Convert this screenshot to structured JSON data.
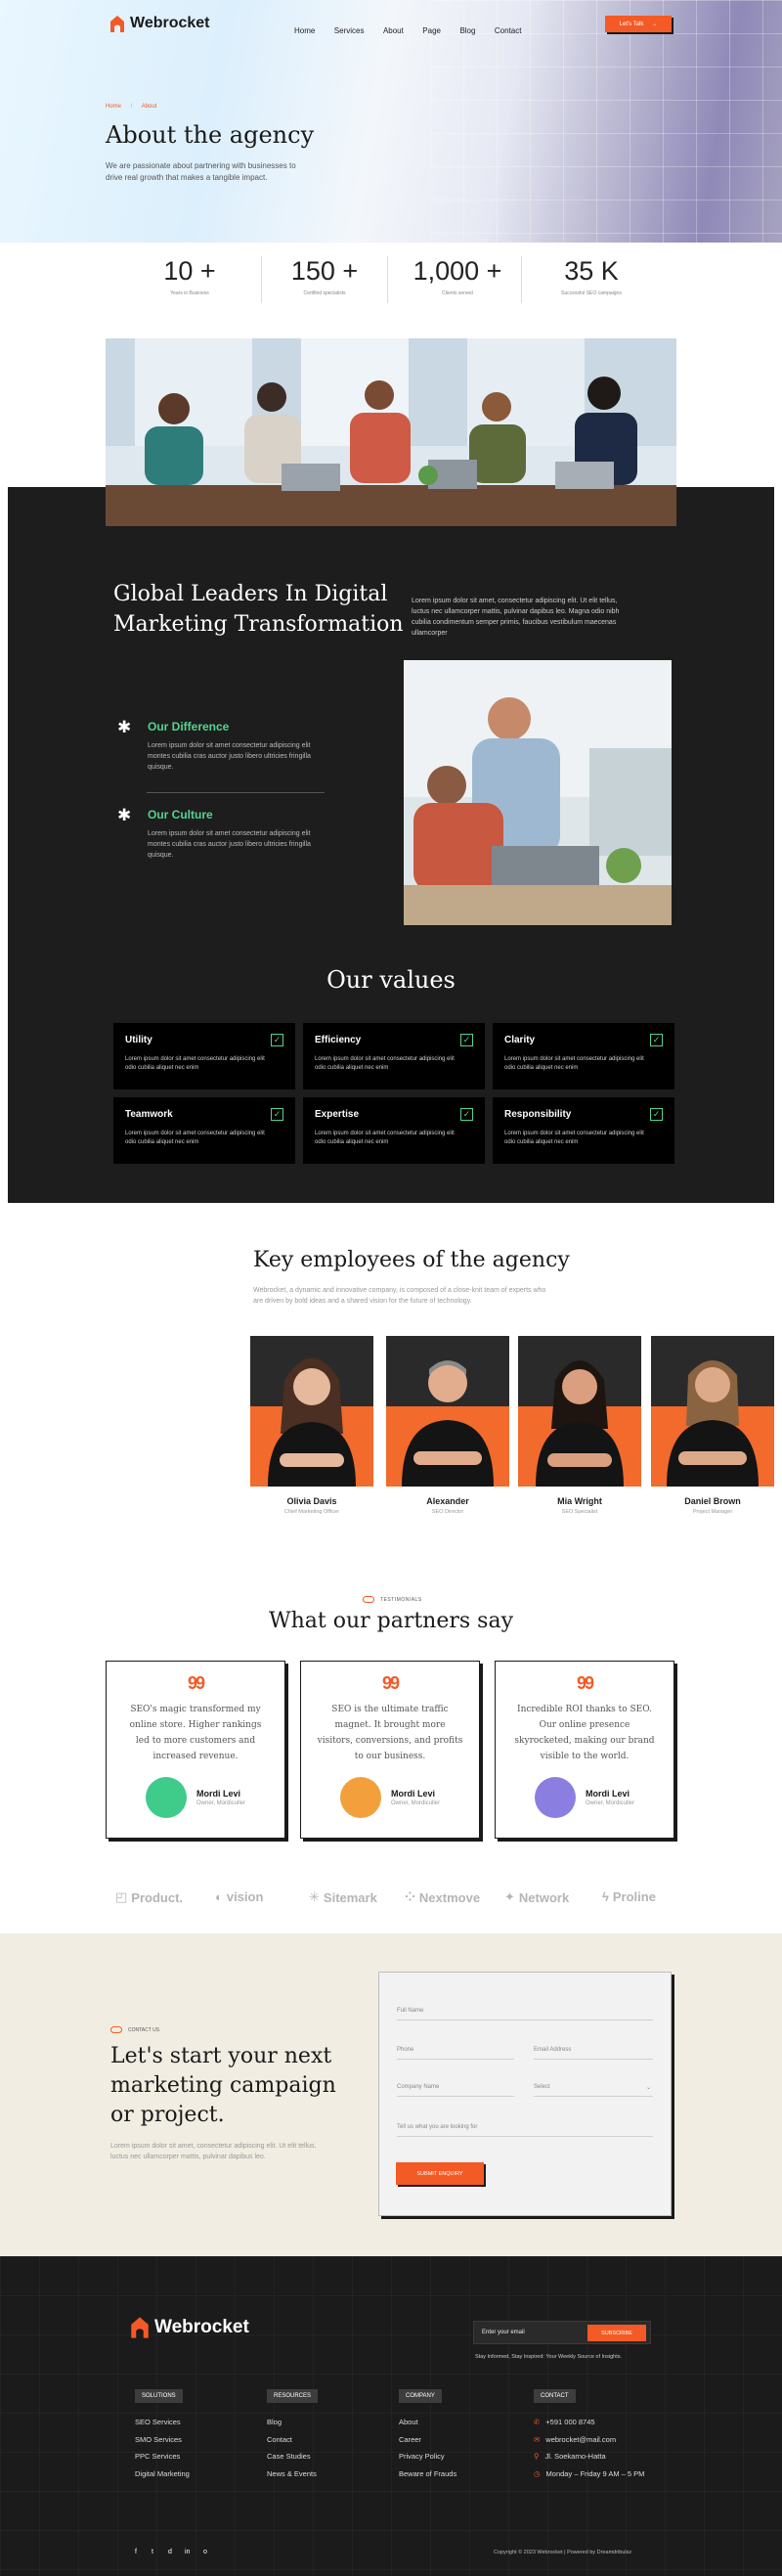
{
  "header": {
    "brand": "Webrocket",
    "nav": [
      "Home",
      "Services",
      "About",
      "Page",
      "Blog",
      "Contact"
    ],
    "cta_label": "Let's Talk",
    "cta_arrow": "→"
  },
  "hero": {
    "breadcrumb_home": "Home",
    "breadcrumb_sep": "/",
    "breadcrumb_current": "About",
    "title": "About the agency",
    "subtitle": "We are passionate about partnering with businesses to drive real growth that makes a tangible impact."
  },
  "stats": [
    {
      "value": "10 +",
      "label": "Years in Business"
    },
    {
      "value": "150 +",
      "label": "Certified specialists"
    },
    {
      "value": "1,000 +",
      "label": "Clients served"
    },
    {
      "value": "35 K",
      "label": "Successful SEO campaigns"
    }
  ],
  "leaders": {
    "title_line1": "Global Leaders In Digital",
    "title_line2": "Marketing Transformation",
    "text": "Lorem ipsum dolor sit amet, consectetur adipiscing elit. Ut elit tellus, luctus nec ullamcorper mattis, pulvinar dapibus leo. Magna odio nibh cubilia condimentum semper primis, faucibus vestibulum maecenas ullamcorper",
    "features": [
      {
        "title": "Our Difference",
        "text": "Lorem ipsum dolor sit amet consectetur adipiscing elit montes cubilia cras auctor justo libero ultricies fringilla quisque."
      },
      {
        "title": "Our Culture",
        "text": "Lorem ipsum dolor sit amet consectetur adipiscing elit montes cubilia cras auctor justo libero ultricies fringilla quisque."
      }
    ]
  },
  "values": {
    "title": "Our values",
    "check_glyph": "✓",
    "items": [
      {
        "title": "Utility",
        "text": "Lorem ipsum dolor sit amet consectetur adipiscing elit odio cubilia aliquet nec enim"
      },
      {
        "title": "Efficiency",
        "text": "Lorem ipsum dolor sit amet consectetur adipiscing elit odio cubilia aliquet nec enim"
      },
      {
        "title": "Clarity",
        "text": "Lorem ipsum dolor sit amet consectetur adipiscing elit odio cubilia aliquet nec enim"
      },
      {
        "title": "Teamwork",
        "text": "Lorem ipsum dolor sit amet consectetur adipiscing elit odio cubilia aliquet nec enim"
      },
      {
        "title": "Expertise",
        "text": "Lorem ipsum dolor sit amet consectetur adipiscing elit odio cubilia aliquet nec enim"
      },
      {
        "title": "Responsibility",
        "text": "Lorem ipsum dolor sit amet consectetur adipiscing elit odio cubilia aliquet nec enim"
      }
    ]
  },
  "team": {
    "title": "Key employees of the agency",
    "subtitle": "Webrocket, a dynamic and innovative company, is composed of a close-knit team of experts who are driven by bold ideas and a shared vision for the future of technology.",
    "members": [
      {
        "name": "Olivia Davis",
        "role": "Chief Marketing Officer"
      },
      {
        "name": "Alexander",
        "role": "SEO Director"
      },
      {
        "name": "Mia Wright",
        "role": "SEO Specialist"
      },
      {
        "name": "Daniel Brown",
        "role": "Project Manager"
      }
    ]
  },
  "testimonials": {
    "tag": "TESTIMONIALS",
    "title": "What our partners say",
    "quote_glyph": "99",
    "items": [
      {
        "text": "SEO's magic transformed my online store. Higher rankings led to more customers and increased revenue.",
        "name": "Mordi Levi",
        "role": "Owner, Mordiculler"
      },
      {
        "text": "SEO is the ultimate traffic magnet. It brought more visitors, conversions, and profits to our business.",
        "name": "Mordi Levi",
        "role": "Owner, Mordiculler"
      },
      {
        "text": "Incredible ROI thanks to SEO. Our online presence skyrocketed, making our brand visible to the world.",
        "name": "Mordi Levi",
        "role": "Owner, Mordiculler"
      }
    ]
  },
  "brands": [
    "Product.",
    "vision",
    "Sitemark",
    "Nextmove",
    "Network",
    "Proline"
  ],
  "contact": {
    "tag": "CONTACT US",
    "title_line1": "Let's start your next",
    "title_line2": "marketing campaign",
    "title_line3": "or project.",
    "text": "Lorem ipsum dolor sit amet, consectetur adipiscing elit. Ut elit tellus, luctus nec ullamcorper mattis, pulvinar dapibus leo.",
    "fields": {
      "full_name": "Full Name",
      "phone": "Phone",
      "email": "Email Address",
      "company": "Company Name",
      "select": "Select",
      "message": "Tell us what you are looking for"
    },
    "submit": "SUBMIT ENQUIRY"
  },
  "footer": {
    "brand": "Webrocket",
    "email_placeholder": "Enter your email",
    "subscribe": "SUBSCRIBE",
    "subscribe_note": "Stay Informed, Stay Inspired: Your Weekly Source of Insights.",
    "columns": [
      {
        "heading": "SOLUTIONS",
        "links": [
          "SEO Services",
          "SMO Services",
          "PPC Services",
          "Digital Marketing"
        ]
      },
      {
        "heading": "RESOURCES",
        "links": [
          "Blog",
          "Contact",
          "Case Studies",
          "News & Events"
        ]
      },
      {
        "heading": "COMPANY",
        "links": [
          "About",
          "Career",
          "Privacy Policy",
          "Beware of Frauds"
        ]
      }
    ],
    "contact_heading": "CONTACT",
    "contact_items": [
      "+591 000 8745",
      "webrocket@mail.com",
      "Jl. Soekarno-Hatta",
      "Monday – Friday 9 AM – 5 PM"
    ],
    "social": [
      "f",
      "t",
      "d",
      "in",
      "o"
    ],
    "copyright": "Copyright © 2023 Webrocket | Powered by Dreamdribulsz"
  },
  "colors": {
    "accent": "#f45a26",
    "green": "#54d48f",
    "dark": "#1d1d1d",
    "cream": "#f1ede2"
  }
}
